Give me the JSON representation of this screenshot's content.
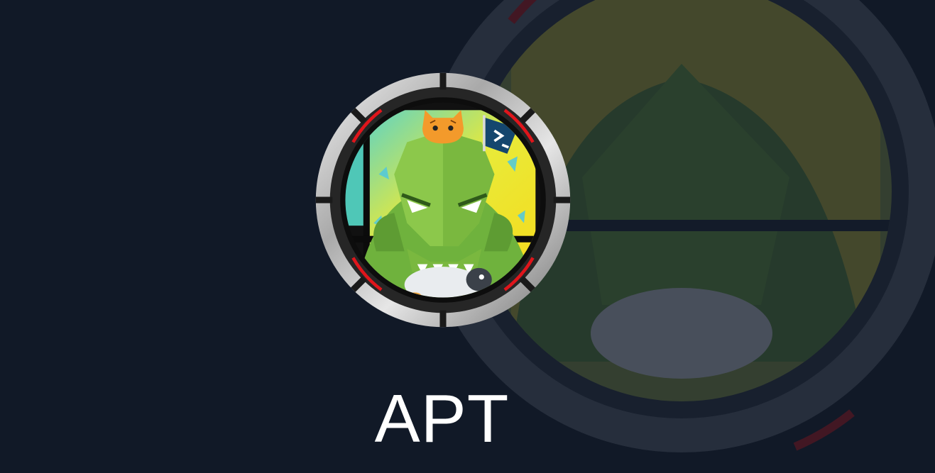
{
  "machine": {
    "name": "APT",
    "avatar_icon": "dinosaur-machine-avatar-icon",
    "backdrop_icon": "dinosaur-machine-avatar-backdrop-icon"
  },
  "colors": {
    "background": "#111927",
    "title": "#ffffff",
    "ring_accent": "#e0151b",
    "dino_green": "#7cc243",
    "sky_yellow": "#f2e61c"
  }
}
